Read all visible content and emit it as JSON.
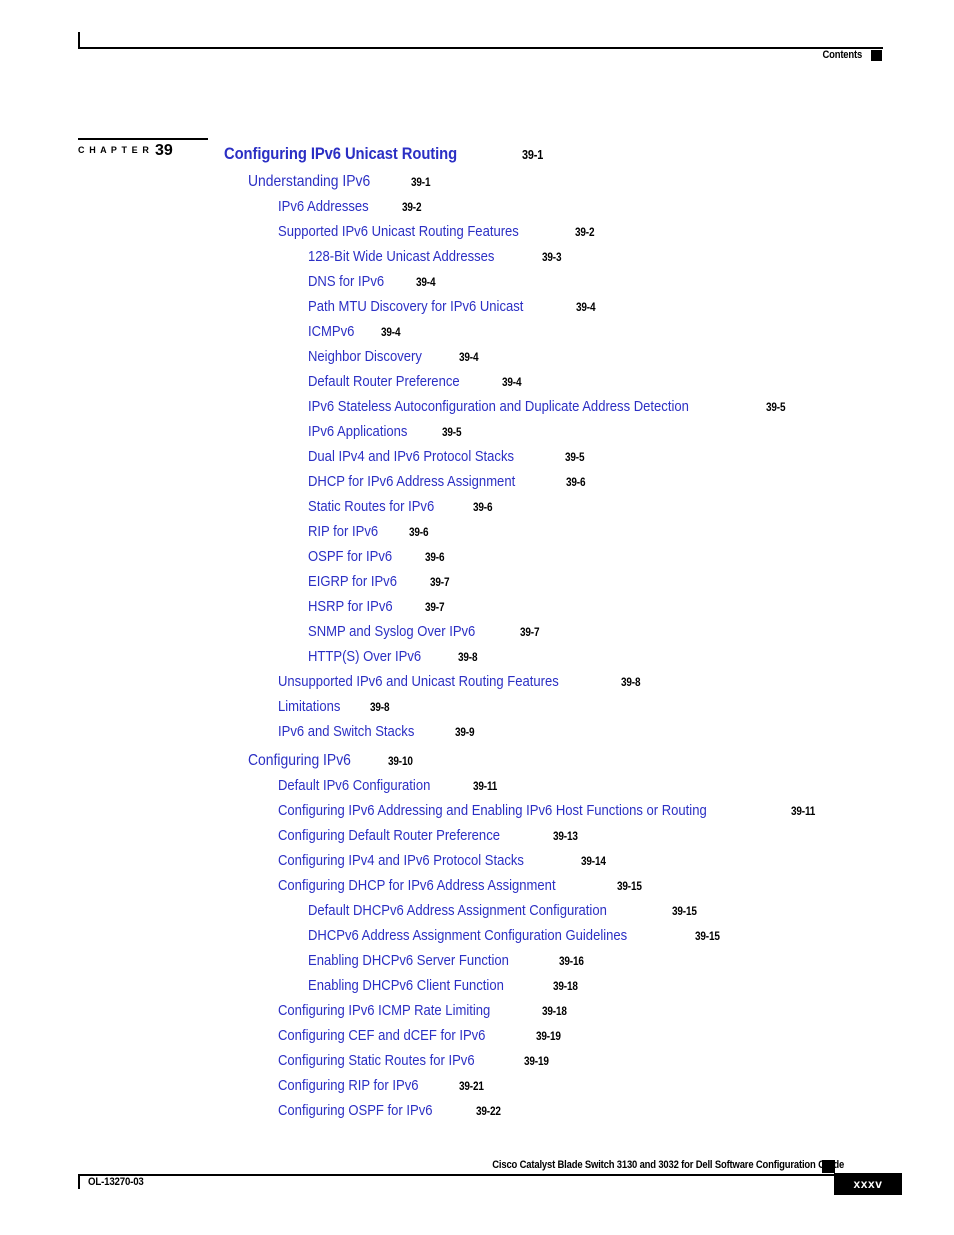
{
  "header": {
    "label": "Contents",
    "marker_icon": "black-square-icon"
  },
  "chapter": {
    "word": "C H A P T E R",
    "number": "39"
  },
  "colors": {
    "link_blue": "#2b2fc4",
    "text_black": "#000000",
    "page_background": "#ffffff"
  },
  "toc": {
    "entries": [
      {
        "level": 0,
        "title": "Configuring IPv6 Unicast Routing",
        "page": "39-1"
      },
      {
        "level": 1,
        "title": "Understanding IPv6",
        "page": "39-1"
      },
      {
        "level": 2,
        "title": "IPv6 Addresses",
        "page": "39-2"
      },
      {
        "level": 2,
        "title": "Supported IPv6 Unicast Routing Features",
        "page": "39-2"
      },
      {
        "level": 3,
        "title": "128-Bit Wide Unicast Addresses",
        "page": "39-3"
      },
      {
        "level": 3,
        "title": "DNS for IPv6",
        "page": "39-4"
      },
      {
        "level": 3,
        "title": "Path MTU Discovery for IPv6 Unicast",
        "page": "39-4"
      },
      {
        "level": 3,
        "title": "ICMPv6",
        "page": "39-4"
      },
      {
        "level": 3,
        "title": "Neighbor Discovery",
        "page": "39-4"
      },
      {
        "level": 3,
        "title": "Default Router Preference",
        "page": "39-4"
      },
      {
        "level": 3,
        "title": "IPv6 Stateless Autoconfiguration and Duplicate Address Detection",
        "page": "39-5"
      },
      {
        "level": 3,
        "title": "IPv6 Applications",
        "page": "39-5"
      },
      {
        "level": 3,
        "title": "Dual IPv4 and IPv6 Protocol Stacks",
        "page": "39-5"
      },
      {
        "level": 3,
        "title": "DHCP for IPv6 Address Assignment",
        "page": "39-6"
      },
      {
        "level": 3,
        "title": "Static Routes for IPv6",
        "page": "39-6"
      },
      {
        "level": 3,
        "title": "RIP for IPv6",
        "page": "39-6"
      },
      {
        "level": 3,
        "title": "OSPF for IPv6",
        "page": "39-6"
      },
      {
        "level": 3,
        "title": "EIGRP for IPv6",
        "page": "39-7"
      },
      {
        "level": 3,
        "title": "HSRP for IPv6",
        "page": "39-7"
      },
      {
        "level": 3,
        "title": "SNMP and Syslog Over IPv6",
        "page": "39-7"
      },
      {
        "level": 3,
        "title": "HTTP(S) Over IPv6",
        "page": "39-8"
      },
      {
        "level": 2,
        "title": "Unsupported IPv6 and Unicast Routing Features",
        "page": "39-8"
      },
      {
        "level": 2,
        "title": "Limitations",
        "page": "39-8"
      },
      {
        "level": 2,
        "title": "IPv6 and Switch Stacks",
        "page": "39-9"
      },
      {
        "level": 1,
        "title": "Configuring IPv6",
        "page": "39-10",
        "section_break": true
      },
      {
        "level": 2,
        "title": "Default IPv6 Configuration",
        "page": "39-11"
      },
      {
        "level": 2,
        "title": "Configuring IPv6 Addressing and Enabling IPv6 Host Functions or Routing",
        "page": "39-11"
      },
      {
        "level": 2,
        "title": "Configuring Default Router Preference",
        "page": "39-13"
      },
      {
        "level": 2,
        "title": "Configuring IPv4 and IPv6 Protocol Stacks",
        "page": "39-14"
      },
      {
        "level": 2,
        "title": "Configuring DHCP for IPv6 Address Assignment",
        "page": "39-15"
      },
      {
        "level": 3,
        "title": "Default DHCPv6 Address Assignment Configuration",
        "page": "39-15"
      },
      {
        "level": 3,
        "title": "DHCPv6 Address Assignment Configuration Guidelines",
        "page": "39-15"
      },
      {
        "level": 3,
        "title": "Enabling DHCPv6 Server Function",
        "page": "39-16"
      },
      {
        "level": 3,
        "title": "Enabling DHCPv6 Client Function",
        "page": "39-18"
      },
      {
        "level": 2,
        "title": "Configuring IPv6 ICMP Rate Limiting",
        "page": "39-18"
      },
      {
        "level": 2,
        "title": "Configuring CEF and dCEF for IPv6",
        "page": "39-19"
      },
      {
        "level": 2,
        "title": "Configuring Static Routes for IPv6",
        "page": "39-19"
      },
      {
        "level": 2,
        "title": "Configuring RIP for IPv6",
        "page": "39-21"
      },
      {
        "level": 2,
        "title": "Configuring OSPF for IPv6",
        "page": "39-22"
      }
    ]
  },
  "footer": {
    "guide_title": "Cisco Catalyst Blade Switch 3130 and 3032 for Dell Software Configuration Guide",
    "marker_icon": "black-square-icon",
    "document_id": "OL-13270-03",
    "page_number": "xxxv"
  }
}
